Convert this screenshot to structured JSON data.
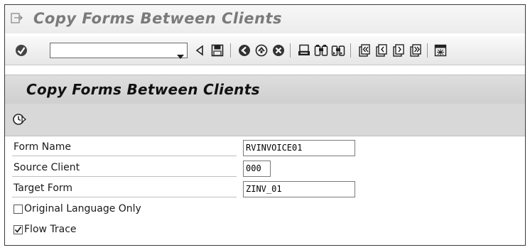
{
  "window": {
    "title": "Copy Forms Between Clients"
  },
  "toolbar": {
    "command_field": {
      "value": "",
      "placeholder": ""
    },
    "icons": [
      "enter-icon",
      "dropdown-icon",
      "back-triangle-icon",
      "save-icon",
      "back-icon",
      "exit-icon",
      "cancel-icon",
      "print-icon",
      "find-icon",
      "find-next-icon",
      "first-page-icon",
      "previous-page-icon",
      "next-page-icon",
      "last-page-icon",
      "layout-icon"
    ]
  },
  "screen": {
    "title": "Copy Forms Between Clients",
    "app_toolbar": {
      "execute_icon": "execute-clock-icon"
    }
  },
  "form": {
    "form_name": {
      "label": "Form Name",
      "value": "RVINVOICE01"
    },
    "source_client": {
      "label": "Source Client",
      "value": "000"
    },
    "target_form": {
      "label": "Target Form",
      "value": "ZINV_01"
    },
    "original_language_only": {
      "label": "Original Language Only",
      "checked": false
    },
    "flow_trace": {
      "label": "Flow Trace",
      "checked": true
    }
  }
}
